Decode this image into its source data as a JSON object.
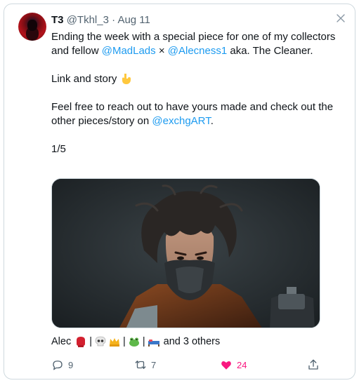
{
  "tweet": {
    "display_name": "T3",
    "handle": "@Tkhl_3",
    "separator": "·",
    "date": "Aug 11",
    "line1_a": "Ending the week with a special piece for one of my collectors and fellow ",
    "mention_madlads": "@MadLads",
    "cross": " × ",
    "mention_alecness": "@Alecness1",
    "line1_b": " aka. The Cleaner.",
    "link_story": "Link and story ",
    "feel_free": "Feel free to reach out to have yours made and check out the other pieces/story on ",
    "mention_exchg": "@exchgART",
    "period": ".",
    "counter": "1/5"
  },
  "reactions": {
    "name": "Alec",
    "separator1": "|",
    "separator2": "|",
    "separator3": "|",
    "others": "and 3 others"
  },
  "actions": {
    "replies": "9",
    "retweets": "7",
    "likes": "24"
  },
  "icons": {
    "close": "close-icon",
    "reply": "reply-icon",
    "retweet": "retweet-icon",
    "like": "heart-icon",
    "share": "share-icon",
    "pointing": "pointing-down-emoji"
  },
  "colors": {
    "link": "#1d9bf0",
    "muted": "#536471",
    "like": "#f91880"
  }
}
